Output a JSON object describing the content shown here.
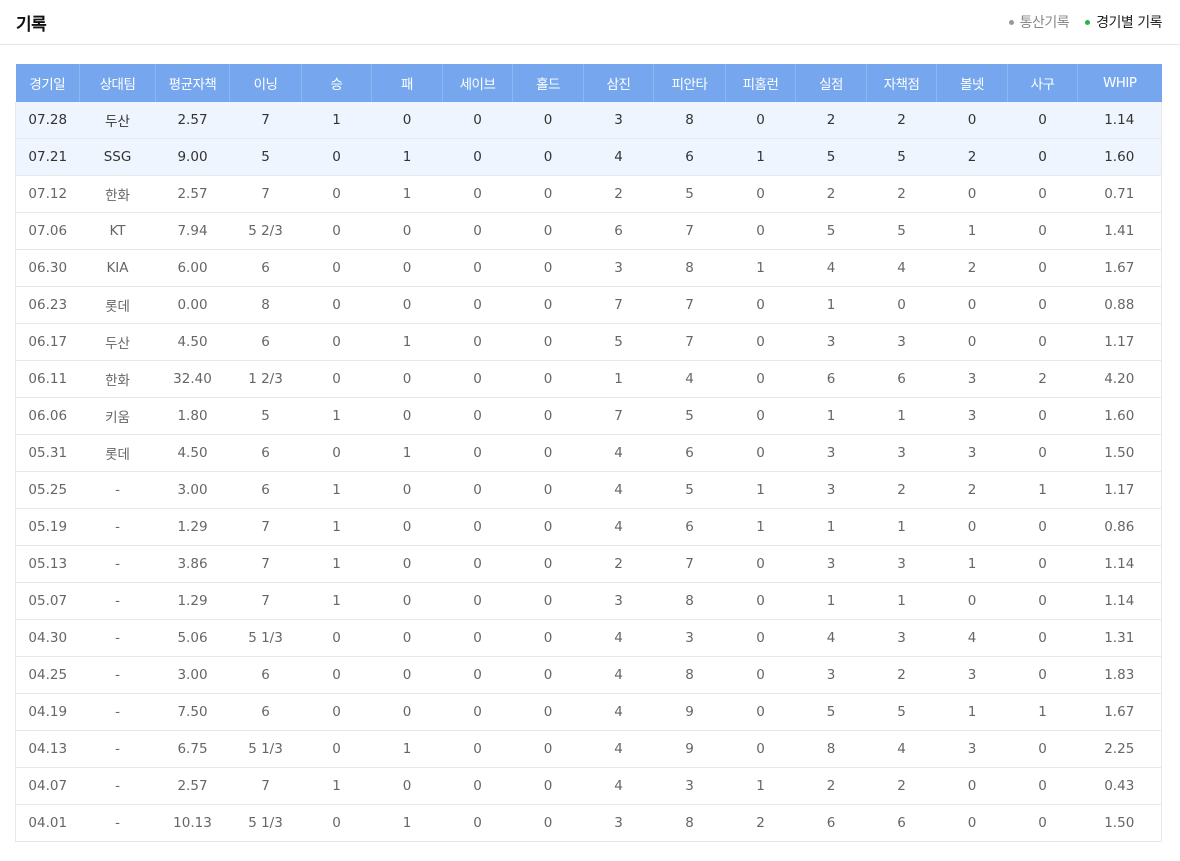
{
  "header": {
    "title": "기록",
    "tabs": [
      {
        "label": "통산기록",
        "active": false
      },
      {
        "label": "경기별 기록",
        "active": true
      }
    ]
  },
  "colors": {
    "header_bg": "#76a7ee",
    "highlight_row": "#eff5fe",
    "active_dot": "#28b446"
  },
  "table": {
    "columns": [
      "경기일",
      "상대팀",
      "평균자책",
      "이닝",
      "승",
      "패",
      "세이브",
      "홀드",
      "삼진",
      "피안타",
      "피홈런",
      "실점",
      "자책점",
      "볼넷",
      "사구",
      "WHIP"
    ],
    "rows": [
      {
        "highlight": true,
        "cells": [
          "07.28",
          "두산",
          "2.57",
          "7",
          "1",
          "0",
          "0",
          "0",
          "3",
          "8",
          "0",
          "2",
          "2",
          "0",
          "0",
          "1.14"
        ]
      },
      {
        "highlight": true,
        "cells": [
          "07.21",
          "SSG",
          "9.00",
          "5",
          "0",
          "1",
          "0",
          "0",
          "4",
          "6",
          "1",
          "5",
          "5",
          "2",
          "0",
          "1.60"
        ]
      },
      {
        "highlight": false,
        "cells": [
          "07.12",
          "한화",
          "2.57",
          "7",
          "0",
          "1",
          "0",
          "0",
          "2",
          "5",
          "0",
          "2",
          "2",
          "0",
          "0",
          "0.71"
        ]
      },
      {
        "highlight": false,
        "cells": [
          "07.06",
          "KT",
          "7.94",
          "5 2/3",
          "0",
          "0",
          "0",
          "0",
          "6",
          "7",
          "0",
          "5",
          "5",
          "1",
          "0",
          "1.41"
        ]
      },
      {
        "highlight": false,
        "cells": [
          "06.30",
          "KIA",
          "6.00",
          "6",
          "0",
          "0",
          "0",
          "0",
          "3",
          "8",
          "1",
          "4",
          "4",
          "2",
          "0",
          "1.67"
        ]
      },
      {
        "highlight": false,
        "cells": [
          "06.23",
          "롯데",
          "0.00",
          "8",
          "0",
          "0",
          "0",
          "0",
          "7",
          "7",
          "0",
          "1",
          "0",
          "0",
          "0",
          "0.88"
        ]
      },
      {
        "highlight": false,
        "cells": [
          "06.17",
          "두산",
          "4.50",
          "6",
          "0",
          "1",
          "0",
          "0",
          "5",
          "7",
          "0",
          "3",
          "3",
          "0",
          "0",
          "1.17"
        ]
      },
      {
        "highlight": false,
        "cells": [
          "06.11",
          "한화",
          "32.40",
          "1 2/3",
          "0",
          "0",
          "0",
          "0",
          "1",
          "4",
          "0",
          "6",
          "6",
          "3",
          "2",
          "4.20"
        ]
      },
      {
        "highlight": false,
        "cells": [
          "06.06",
          "키움",
          "1.80",
          "5",
          "1",
          "0",
          "0",
          "0",
          "7",
          "5",
          "0",
          "1",
          "1",
          "3",
          "0",
          "1.60"
        ]
      },
      {
        "highlight": false,
        "cells": [
          "05.31",
          "롯데",
          "4.50",
          "6",
          "0",
          "1",
          "0",
          "0",
          "4",
          "6",
          "0",
          "3",
          "3",
          "3",
          "0",
          "1.50"
        ]
      },
      {
        "highlight": false,
        "cells": [
          "05.25",
          "-",
          "3.00",
          "6",
          "1",
          "0",
          "0",
          "0",
          "4",
          "5",
          "1",
          "3",
          "2",
          "2",
          "1",
          "1.17"
        ]
      },
      {
        "highlight": false,
        "cells": [
          "05.19",
          "-",
          "1.29",
          "7",
          "1",
          "0",
          "0",
          "0",
          "4",
          "6",
          "1",
          "1",
          "1",
          "0",
          "0",
          "0.86"
        ]
      },
      {
        "highlight": false,
        "cells": [
          "05.13",
          "-",
          "3.86",
          "7",
          "1",
          "0",
          "0",
          "0",
          "2",
          "7",
          "0",
          "3",
          "3",
          "1",
          "0",
          "1.14"
        ]
      },
      {
        "highlight": false,
        "cells": [
          "05.07",
          "-",
          "1.29",
          "7",
          "1",
          "0",
          "0",
          "0",
          "3",
          "8",
          "0",
          "1",
          "1",
          "0",
          "0",
          "1.14"
        ]
      },
      {
        "highlight": false,
        "cells": [
          "04.30",
          "-",
          "5.06",
          "5 1/3",
          "0",
          "0",
          "0",
          "0",
          "4",
          "3",
          "0",
          "4",
          "3",
          "4",
          "0",
          "1.31"
        ]
      },
      {
        "highlight": false,
        "cells": [
          "04.25",
          "-",
          "3.00",
          "6",
          "0",
          "0",
          "0",
          "0",
          "4",
          "8",
          "0",
          "3",
          "2",
          "3",
          "0",
          "1.83"
        ]
      },
      {
        "highlight": false,
        "cells": [
          "04.19",
          "-",
          "7.50",
          "6",
          "0",
          "0",
          "0",
          "0",
          "4",
          "9",
          "0",
          "5",
          "5",
          "1",
          "1",
          "1.67"
        ]
      },
      {
        "highlight": false,
        "cells": [
          "04.13",
          "-",
          "6.75",
          "5 1/3",
          "0",
          "1",
          "0",
          "0",
          "4",
          "9",
          "0",
          "8",
          "4",
          "3",
          "0",
          "2.25"
        ]
      },
      {
        "highlight": false,
        "cells": [
          "04.07",
          "-",
          "2.57",
          "7",
          "1",
          "0",
          "0",
          "0",
          "4",
          "3",
          "1",
          "2",
          "2",
          "0",
          "0",
          "0.43"
        ]
      },
      {
        "highlight": false,
        "cells": [
          "04.01",
          "-",
          "10.13",
          "5 1/3",
          "0",
          "1",
          "0",
          "0",
          "3",
          "8",
          "2",
          "6",
          "6",
          "0",
          "0",
          "1.50"
        ]
      }
    ]
  }
}
